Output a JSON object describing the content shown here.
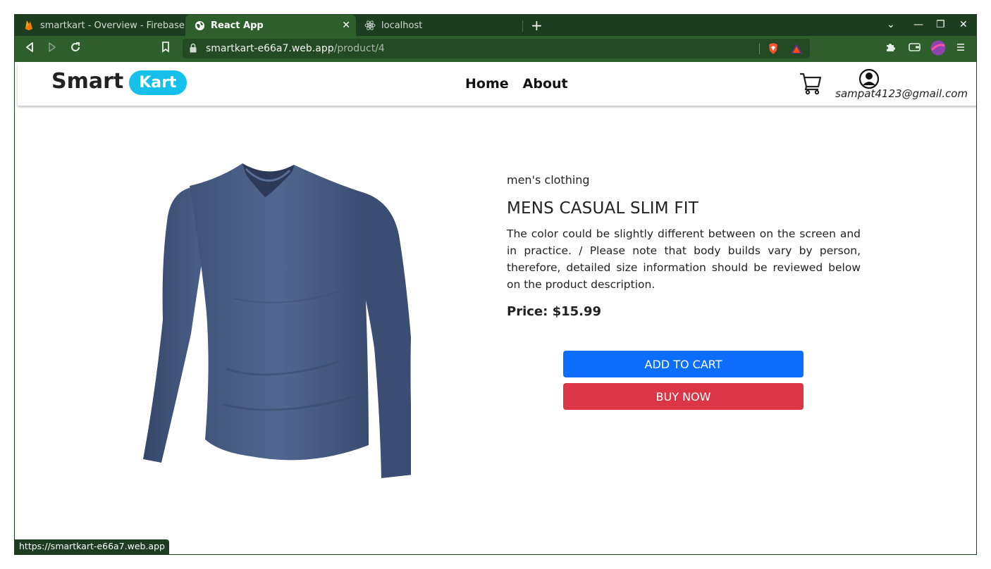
{
  "browser": {
    "tabs": [
      {
        "title": "smartkart - Overview - Firebase console",
        "icon": "firebase-icon",
        "active": false
      },
      {
        "title": "React App",
        "icon": "globe-icon",
        "active": true
      },
      {
        "title": "localhost",
        "icon": "react-icon",
        "active": false
      }
    ],
    "url_host": "smartkart-e66a7.web.app",
    "url_path": "/product/4",
    "status_url": "https://smartkart-e66a7.web.app"
  },
  "navbar": {
    "logo_smart": "Smart",
    "logo_kart": "Kart",
    "links": [
      "Home",
      "About"
    ],
    "user_email": "sampat4123@gmail.com"
  },
  "product": {
    "category": "men's clothing",
    "title": "MENS CASUAL SLIM FIT",
    "description": "The color could be slightly different between on the screen and in practice. / Please note that body builds vary by person, therefore, detailed size information should be reviewed below on the product description.",
    "price": "Price: $15.99",
    "image": "long-sleeve-tshirt",
    "add_to_cart": "ADD TO CART",
    "buy_now": "BUY NOW"
  },
  "colors": {
    "accent_logo": "#17c0eb",
    "primary_button": "#0d6efd",
    "danger_button": "#dc3545",
    "browser_frame": "#2d5e2b"
  }
}
